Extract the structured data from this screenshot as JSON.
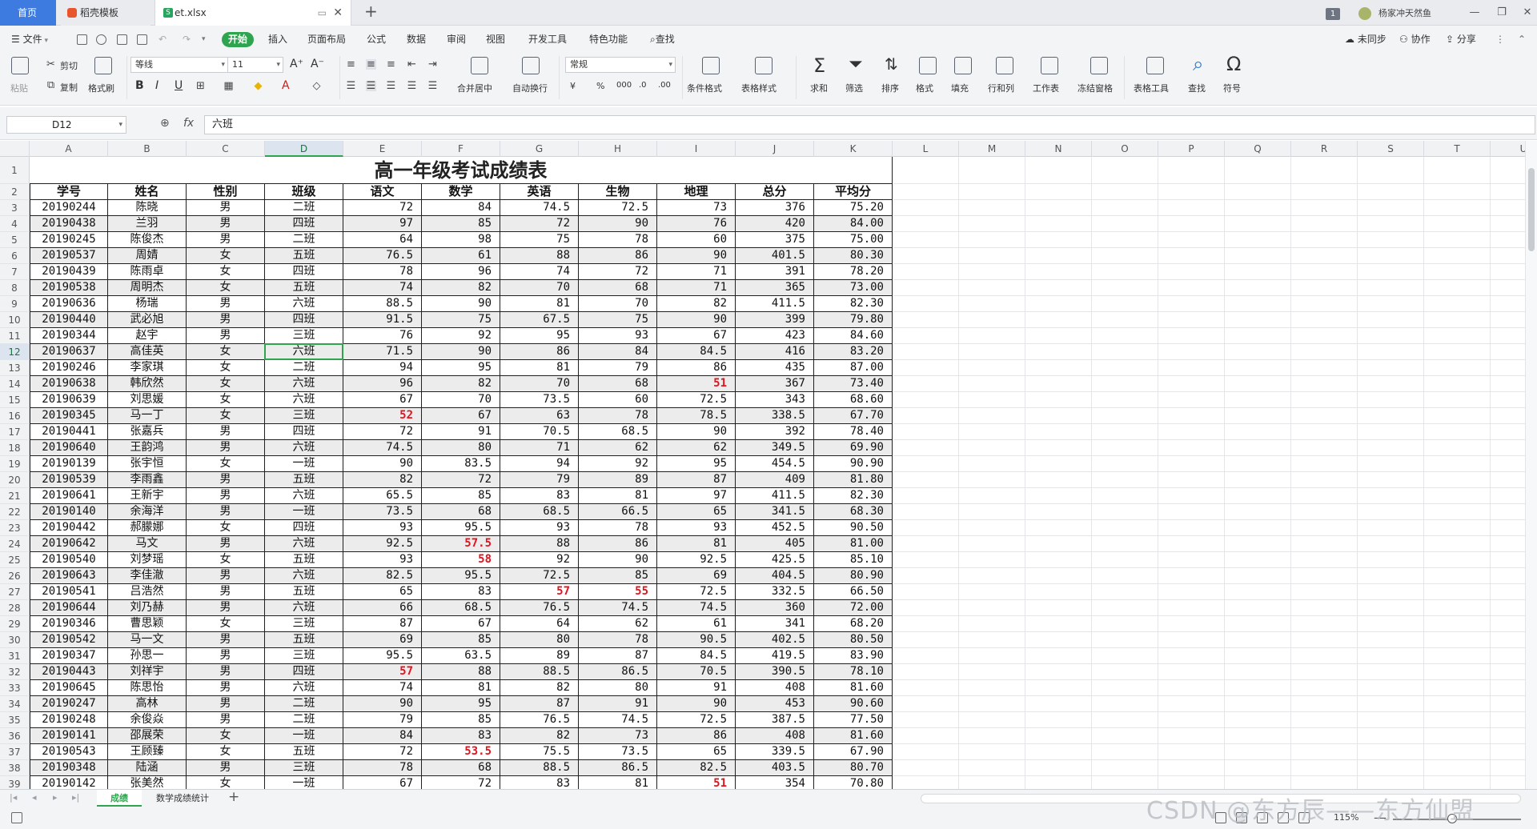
{
  "tabs": {
    "home": "首页",
    "template": "稻壳模板",
    "file": "et.xlsx"
  },
  "topbar": {
    "badge": "1",
    "user": "杨家冲天然鱼"
  },
  "menu": {
    "file": "文件",
    "start": "开始",
    "insert": "插入",
    "layout": "页面布局",
    "formula": "公式",
    "data": "数据",
    "review": "审阅",
    "view": "视图",
    "dev": "开发工具",
    "special": "特色功能",
    "search": "查找",
    "unsync": "未同步",
    "collab": "协作",
    "share": "分享"
  },
  "ribbon": {
    "paste": "粘贴",
    "cut": "剪切",
    "copy": "复制",
    "format_painter": "格式刷",
    "font_name": "等线",
    "font_size": "11",
    "bold": "B",
    "italic": "I",
    "underline": "U",
    "merge_center": "合并居中",
    "wrap": "自动换行",
    "number_format": "常规",
    "cond_format": "条件格式",
    "table_style": "表格样式",
    "sum": "求和",
    "filter": "筛选",
    "sort": "排序",
    "format": "格式",
    "fill": "填充",
    "rowcol": "行和列",
    "worksheet": "工作表",
    "freeze": "冻结窗格",
    "table_tools": "表格工具",
    "find": "查找",
    "symbol": "符号"
  },
  "formula_bar": {
    "name_box": "D12",
    "fx": "fx",
    "content": "六班"
  },
  "sheet": {
    "columns": [
      "A",
      "B",
      "C",
      "D",
      "E",
      "F",
      "G",
      "H",
      "I",
      "J",
      "K",
      "L",
      "M",
      "N",
      "O",
      "P",
      "Q",
      "R",
      "S",
      "T",
      "U"
    ],
    "selected_column": "D",
    "selected_row": "12",
    "title": "高一年级考试成绩表",
    "headers": [
      "学号",
      "姓名",
      "性别",
      "班级",
      "语文",
      "数学",
      "英语",
      "生物",
      "地理",
      "总分",
      "平均分"
    ],
    "rows": [
      [
        "20190244",
        "陈晓",
        "男",
        "二班",
        "72",
        "84",
        "74.5",
        "72.5",
        "73",
        "376",
        "75.20"
      ],
      [
        "20190438",
        "兰羽",
        "男",
        "四班",
        "97",
        "85",
        "72",
        "90",
        "76",
        "420",
        "84.00"
      ],
      [
        "20190245",
        "陈俊杰",
        "男",
        "二班",
        "64",
        "98",
        "75",
        "78",
        "60",
        "375",
        "75.00"
      ],
      [
        "20190537",
        "周婧",
        "女",
        "五班",
        "76.5",
        "61",
        "88",
        "86",
        "90",
        "401.5",
        "80.30"
      ],
      [
        "20190439",
        "陈雨卓",
        "女",
        "四班",
        "78",
        "96",
        "74",
        "72",
        "71",
        "391",
        "78.20"
      ],
      [
        "20190538",
        "周明杰",
        "女",
        "五班",
        "74",
        "82",
        "70",
        "68",
        "71",
        "365",
        "73.00"
      ],
      [
        "20190636",
        "杨瑞",
        "男",
        "六班",
        "88.5",
        "90",
        "81",
        "70",
        "82",
        "411.5",
        "82.30"
      ],
      [
        "20190440",
        "武必旭",
        "男",
        "四班",
        "91.5",
        "75",
        "67.5",
        "75",
        "90",
        "399",
        "79.80"
      ],
      [
        "20190344",
        "赵宇",
        "男",
        "三班",
        "76",
        "92",
        "95",
        "93",
        "67",
        "423",
        "84.60"
      ],
      [
        "20190637",
        "高佳英",
        "女",
        "六班",
        "71.5",
        "90",
        "86",
        "84",
        "84.5",
        "416",
        "83.20"
      ],
      [
        "20190246",
        "李家琪",
        "女",
        "二班",
        "94",
        "95",
        "81",
        "79",
        "86",
        "435",
        "87.00"
      ],
      [
        "20190638",
        "韩欣然",
        "女",
        "六班",
        "96",
        "82",
        "70",
        "68",
        "51",
        "367",
        "73.40"
      ],
      [
        "20190639",
        "刘思媛",
        "女",
        "六班",
        "67",
        "70",
        "73.5",
        "60",
        "72.5",
        "343",
        "68.60"
      ],
      [
        "20190345",
        "马一丁",
        "女",
        "三班",
        "52",
        "67",
        "63",
        "78",
        "78.5",
        "338.5",
        "67.70"
      ],
      [
        "20190441",
        "张嘉兵",
        "男",
        "四班",
        "72",
        "91",
        "70.5",
        "68.5",
        "90",
        "392",
        "78.40"
      ],
      [
        "20190640",
        "王韵鸿",
        "男",
        "六班",
        "74.5",
        "80",
        "71",
        "62",
        "62",
        "349.5",
        "69.90"
      ],
      [
        "20190139",
        "张宇恒",
        "女",
        "一班",
        "90",
        "83.5",
        "94",
        "92",
        "95",
        "454.5",
        "90.90"
      ],
      [
        "20190539",
        "李雨鑫",
        "男",
        "五班",
        "82",
        "72",
        "79",
        "89",
        "87",
        "409",
        "81.80"
      ],
      [
        "20190641",
        "王新宇",
        "男",
        "六班",
        "65.5",
        "85",
        "83",
        "81",
        "97",
        "411.5",
        "82.30"
      ],
      [
        "20190140",
        "余海洋",
        "男",
        "一班",
        "73.5",
        "68",
        "68.5",
        "66.5",
        "65",
        "341.5",
        "68.30"
      ],
      [
        "20190442",
        "郝朦娜",
        "女",
        "四班",
        "93",
        "95.5",
        "93",
        "78",
        "93",
        "452.5",
        "90.50"
      ],
      [
        "20190642",
        "马文",
        "男",
        "六班",
        "92.5",
        "57.5",
        "88",
        "86",
        "81",
        "405",
        "81.00"
      ],
      [
        "20190540",
        "刘梦瑶",
        "女",
        "五班",
        "93",
        "58",
        "92",
        "90",
        "92.5",
        "425.5",
        "85.10"
      ],
      [
        "20190643",
        "李佳澈",
        "男",
        "六班",
        "82.5",
        "95.5",
        "72.5",
        "85",
        "69",
        "404.5",
        "80.90"
      ],
      [
        "20190541",
        "吕浩然",
        "男",
        "五班",
        "65",
        "83",
        "57",
        "55",
        "72.5",
        "332.5",
        "66.50"
      ],
      [
        "20190644",
        "刘乃赫",
        "男",
        "六班",
        "66",
        "68.5",
        "76.5",
        "74.5",
        "74.5",
        "360",
        "72.00"
      ],
      [
        "20190346",
        "曹思颖",
        "女",
        "三班",
        "87",
        "67",
        "64",
        "62",
        "61",
        "341",
        "68.20"
      ],
      [
        "20190542",
        "马一文",
        "男",
        "五班",
        "69",
        "85",
        "80",
        "78",
        "90.5",
        "402.5",
        "80.50"
      ],
      [
        "20190347",
        "孙思一",
        "男",
        "三班",
        "95.5",
        "63.5",
        "89",
        "87",
        "84.5",
        "419.5",
        "83.90"
      ],
      [
        "20190443",
        "刘祥宇",
        "男",
        "四班",
        "57",
        "88",
        "88.5",
        "86.5",
        "70.5",
        "390.5",
        "78.10"
      ],
      [
        "20190645",
        "陈思怡",
        "男",
        "六班",
        "74",
        "81",
        "82",
        "80",
        "91",
        "408",
        "81.60"
      ],
      [
        "20190247",
        "高林",
        "男",
        "二班",
        "90",
        "95",
        "87",
        "91",
        "90",
        "453",
        "90.60"
      ],
      [
        "20190248",
        "余俊焱",
        "男",
        "二班",
        "79",
        "85",
        "76.5",
        "74.5",
        "72.5",
        "387.5",
        "77.50"
      ],
      [
        "20190141",
        "邵展荣",
        "女",
        "一班",
        "84",
        "83",
        "82",
        "73",
        "86",
        "408",
        "81.60"
      ],
      [
        "20190543",
        "王顾臻",
        "女",
        "五班",
        "72",
        "53.5",
        "75.5",
        "73.5",
        "65",
        "339.5",
        "67.90"
      ],
      [
        "20190348",
        "陆涵",
        "男",
        "三班",
        "78",
        "68",
        "88.5",
        "86.5",
        "82.5",
        "403.5",
        "80.70"
      ],
      [
        "20190142",
        "张美然",
        "女",
        "一班",
        "67",
        "72",
        "83",
        "81",
        "51",
        "354",
        "70.80"
      ]
    ],
    "failing_threshold": 60,
    "red_color": "#e0141e"
  },
  "sheet_tabs": {
    "active": "成绩",
    "second": "数学成绩统计"
  },
  "status": {
    "zoom": "115%",
    "watermark": "CSDN @东方辰——东方仙盟"
  }
}
